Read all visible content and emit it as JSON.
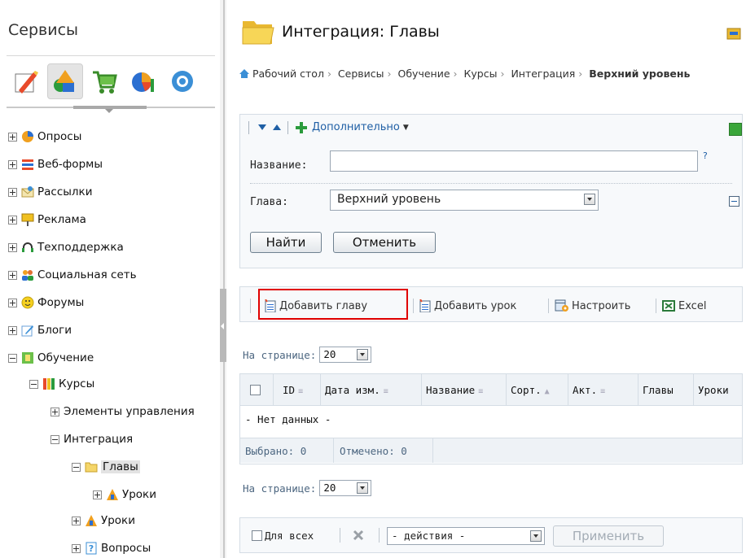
{
  "sidebar": {
    "title": "Сервисы",
    "tree": [
      {
        "label": "Опросы"
      },
      {
        "label": "Веб-формы"
      },
      {
        "label": "Рассылки"
      },
      {
        "label": "Реклама"
      },
      {
        "label": "Техподдержка"
      },
      {
        "label": "Социальная сеть"
      },
      {
        "label": "Форумы"
      },
      {
        "label": "Блоги"
      },
      {
        "label": "Обучение"
      },
      {
        "label": "Курсы"
      },
      {
        "label": "Элементы управления"
      },
      {
        "label": "Интеграция"
      },
      {
        "label": "Главы"
      },
      {
        "label": "Уроки"
      },
      {
        "label": "Уроки"
      },
      {
        "label": "Вопросы"
      }
    ]
  },
  "main": {
    "title": "Интеграция: Главы",
    "breadcrumb": [
      "Рабочий стол",
      "Сервисы",
      "Обучение",
      "Курсы",
      "Интеграция"
    ],
    "breadcrumb_current": "Верхний уровень",
    "filter": {
      "more_label": "Дополнительно",
      "help_mark": "?",
      "name_label": "Название:",
      "name_value": "",
      "chapter_label": "Глава:",
      "chapter_value": "Верхний уровень",
      "find_label": "Найти",
      "cancel_label": "Отменить"
    },
    "toolbar": {
      "add_chapter": "Добавить главу",
      "add_lesson": "Добавить урок",
      "settings": "Настроить",
      "excel": "Excel"
    },
    "per_page_label": "На странице:",
    "per_page_value": "20",
    "grid": {
      "columns": [
        "ID",
        "Дата изм.",
        "Название",
        "Сорт.",
        "Акт.",
        "Главы",
        "Уроки"
      ],
      "empty_text": "- Нет данных -",
      "selected_label": "Выбрано: 0",
      "checked_label": "Отмечено: 0"
    },
    "bottom": {
      "for_all_label": "Для всех",
      "action_value": "- действия -",
      "apply_label": "Применить"
    }
  },
  "colors": {
    "accent": "#2a5a8a",
    "highlight": "#e00000",
    "folder": "#f2c94c"
  }
}
